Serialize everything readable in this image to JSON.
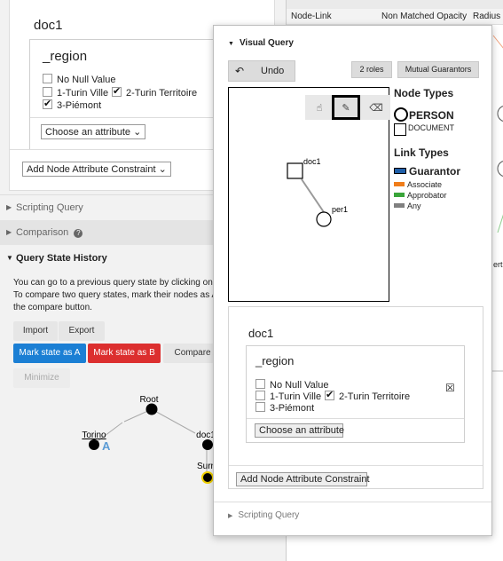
{
  "left_panel": {
    "doc_title": "doc1",
    "region_title": "_region",
    "options": [
      {
        "label": "No Null Value",
        "checked": false
      },
      {
        "label": "1-Turin Ville",
        "checked": false
      },
      {
        "label": "2-Turin Territoire",
        "checked": true
      },
      {
        "label": "3-Piémont",
        "checked": true
      }
    ],
    "choose_attribute": "Choose an attribute ⌄",
    "add_constraint": "Add Node Attribute Constraint ⌄",
    "scripting_query": "Scripting Query",
    "comparison": "Comparison",
    "query_state_history": "Query State History",
    "description_line1": "You can go to a previous query state by clicking on a no",
    "description_line2": "To compare two query states, mark their nodes as A an",
    "description_line3": "the compare button.",
    "import_label": "Import",
    "export_label": "Export",
    "mark_a_label": "Mark state as A",
    "mark_b_label": "Mark state as B",
    "compare_label": "Compare A",
    "minimize_label": "Minimize",
    "tree": {
      "root": "Root",
      "torino": "Torino",
      "torino_mark": "A",
      "doc1": "doc1",
      "surr": "Surr"
    }
  },
  "right_panel": {
    "header_node_link": "Node-Link",
    "header_opacity": "Non Matched Opacity",
    "header_radius": "Radius",
    "partial_text": "ert"
  },
  "visual_query": {
    "title": "Visual Query",
    "undo_label": "Undo",
    "roles_label": "2 roles",
    "mutual_label": "Mutual Guarantors",
    "nodes": {
      "doc": "doc1",
      "per": "per1"
    },
    "node_types_title": "Node Types",
    "node_types": [
      {
        "label": "PERSON",
        "shape": "circle"
      },
      {
        "label": "DOCUMENT",
        "shape": "square"
      }
    ],
    "link_types_title": "Link Types",
    "link_types": [
      {
        "label": "Guarantor",
        "color": "#1f5fa8"
      },
      {
        "label": "Associate",
        "color": "#f07d1a"
      },
      {
        "label": "Approbator",
        "color": "#3aa53a"
      },
      {
        "label": "Any",
        "color": "#808080"
      }
    ],
    "doc_title": "doc1",
    "region_title": "_region",
    "options": [
      {
        "label": "No Null Value",
        "checked": false
      },
      {
        "label": "1-Turin Ville",
        "checked": false
      },
      {
        "label": "2-Turin Territoire",
        "checked": true
      },
      {
        "label": "3-Piémont",
        "checked": false
      }
    ],
    "remove_symbol": "☒",
    "choose_attribute": "Choose an attribute",
    "add_constraint": "Add Node Attribute Constraint",
    "scripting_query": "Scripting Query"
  },
  "colors": {
    "mark_a": "#1b7fd4",
    "mark_b": "#dc2f2f",
    "accent_blue": "#5b9bd5"
  }
}
